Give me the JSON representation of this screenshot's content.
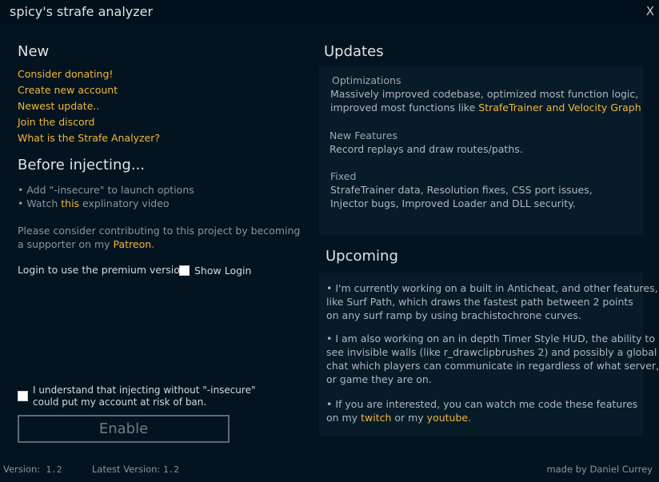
{
  "window": {
    "title": "spicy's strafe analyzer",
    "close_label": "X"
  },
  "new_section": {
    "heading": "New",
    "links": [
      "Consider donating!",
      "Create new account",
      "Newest update..",
      "Join the discord",
      "What is the Strafe Analyzer?"
    ]
  },
  "before_injecting": {
    "heading": "Before injecting...",
    "bullet1": "• Add \"-insecure\" to launch options",
    "bullet2_prefix": "• Watch ",
    "bullet2_link": "this",
    "bullet2_suffix": " explinatory video",
    "support_line1": "Please consider contributing to this project by becoming",
    "support_line2_prefix": "a supporter on my ",
    "support_link": "Patreon",
    "support_line2_suffix": "."
  },
  "login": {
    "label": "Login to use the premium version",
    "show_login_label": "Show Login",
    "show_login_checked": false
  },
  "consent": {
    "line1": "I understand that injecting without \"-insecure\"",
    "line2": "could put my account at risk of ban.",
    "checked": false
  },
  "enable_button": {
    "label": "Enable",
    "enabled": false
  },
  "updates": {
    "heading": "Updates",
    "optimizations_title": "Optimizations",
    "optimizations_line1": "Massively improved codebase, optimized most function logic,",
    "optimizations_line2_prefix": "improved most functions like ",
    "optimizations_line2_highlight": "StrafeTrainer and Velocity Graph",
    "new_features_title": "New Features",
    "new_features_line1": "Record replays and draw routes/paths.",
    "fixed_title": "Fixed",
    "fixed_line1": "StrafeTrainer data, Resolution fixes, CSS port issues,",
    "fixed_line2": "Injector bugs, Improved Loader and DLL security."
  },
  "upcoming": {
    "heading": "Upcoming",
    "p1_line1": "• I'm currently working on a built in Anticheat, and other features,",
    "p1_line2": "like Surf Path, which draws the fastest path between 2 points",
    "p1_line3": "on any surf ramp by using brachistochrone curves.",
    "p2_line1": "• I am also working on an in depth Timer Style HUD, the ability to",
    "p2_line2": "see invisible walls (like r_drawclipbrushes 2) and possibly a global",
    "p2_line3": "chat which players can communicate in regardless of what server,",
    "p2_line4": "or game they are on.",
    "p3_line1": "• If you are interested, you can watch me code these features",
    "p3_line2_prefix": "on my ",
    "p3_twitch": "twitch",
    "p3_or": " or my ",
    "p3_youtube": "youtube",
    "p3_end": "."
  },
  "footer": {
    "version_label": "Version:",
    "version_value": "1.2",
    "latest_label": "Latest Version:",
    "latest_value": "1.2",
    "credit": "made by Daniel Currey"
  },
  "colors": {
    "background": "#031420",
    "panel": "#071b29",
    "accent_orange": "#f2b63a",
    "text": "#b0b6bc"
  }
}
